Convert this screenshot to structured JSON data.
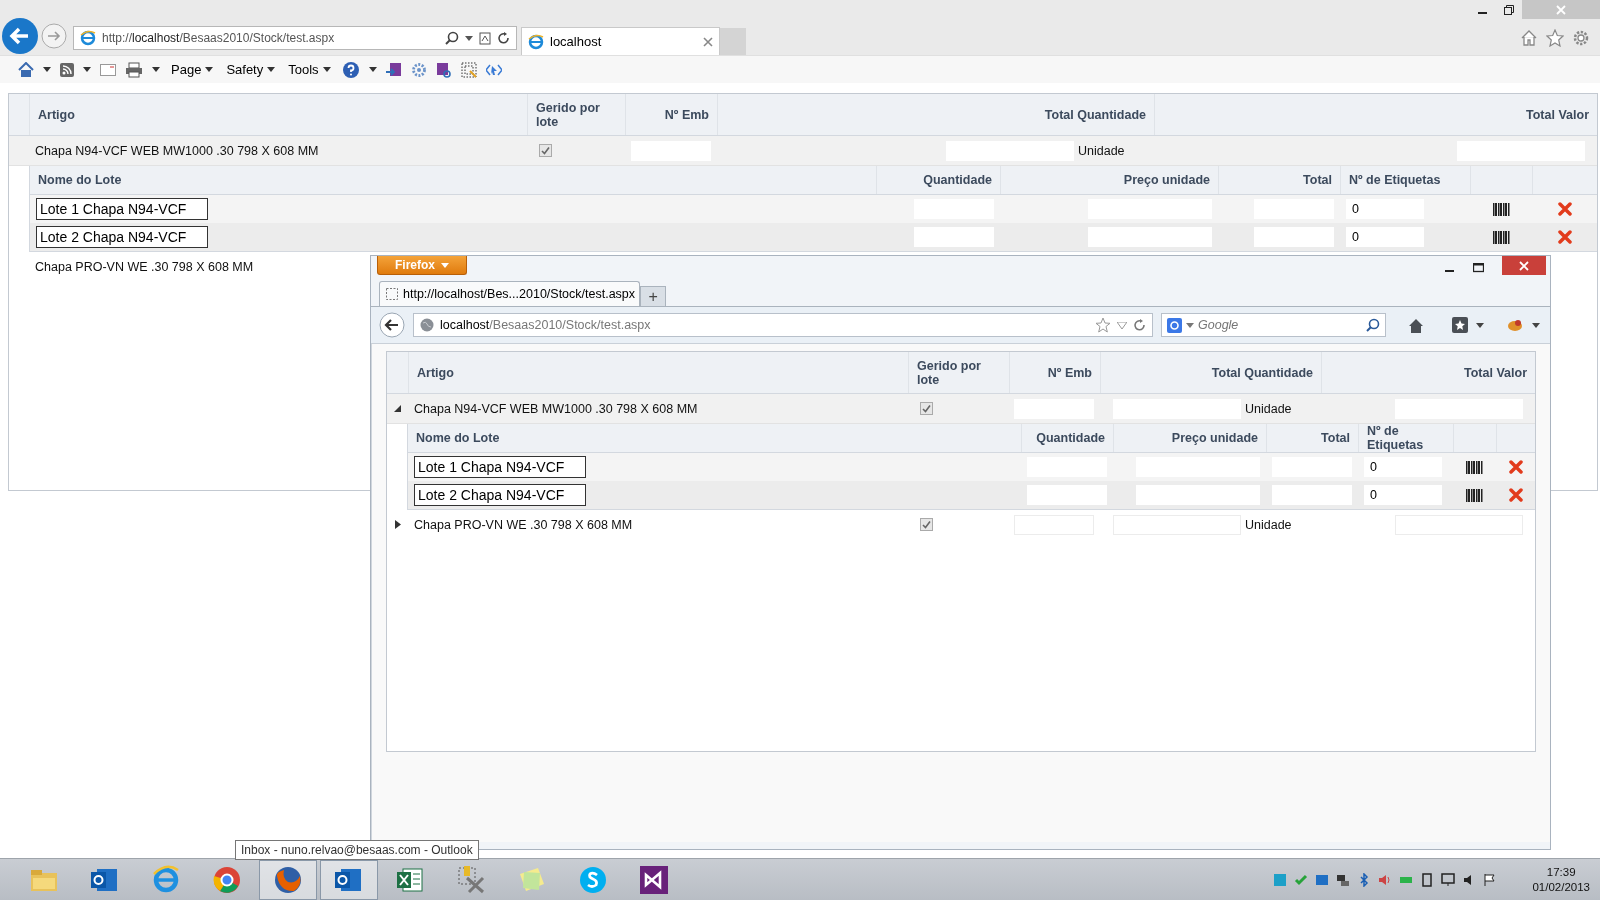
{
  "ie": {
    "address": "http://**localhost**/Besaas2010/Stock/test.aspx",
    "tab": "localhost",
    "commands": [
      "Page",
      "Safety",
      "Tools"
    ],
    "grid": {
      "columns": [
        "Artigo",
        "Gerido por lote",
        "Nº Emb",
        "Total Quantidade",
        "Total Valor"
      ],
      "rows": [
        {
          "name": "Chapa N94-VCF WEB MW1000 .30 798 X 608 MM",
          "managed": true,
          "unit": "Unidade",
          "lots": {
            "columns": [
              "Nome do Lote",
              "Quantidade",
              "Preço unidade",
              "Total",
              "Nº de Etiquetas"
            ],
            "rows": [
              {
                "name": "Lote 1 Chapa N94-VCF",
                "labels": "0"
              },
              {
                "name": "Lote 2 Chapa N94-VCF",
                "labels": "0"
              }
            ]
          }
        },
        {
          "name": "Chapa PRO-VN WE .30 798 X 608 MM"
        }
      ]
    }
  },
  "firefox": {
    "menu_button": "Firefox",
    "tab": "http://localhost/Bes...2010/Stock/test.aspx",
    "new_tab": "+",
    "address_host": "localhost",
    "address_path": "/Besaas2010/Stock/test.aspx",
    "search_placeholder": "Google",
    "grid": {
      "columns": [
        "Artigo",
        "Gerido por lote",
        "Nº Emb",
        "Total Quantidade",
        "Total Valor"
      ],
      "rows": [
        {
          "name": "Chapa N94-VCF WEB MW1000 .30 798 X 608 MM",
          "expanded": true,
          "managed": true,
          "unit": "Unidade",
          "lots": {
            "columns": [
              "Nome do Lote",
              "Quantidade",
              "Preço unidade",
              "Total",
              "Nº de Etiquetas"
            ],
            "rows": [
              {
                "name": "Lote 1 Chapa N94-VCF",
                "labels": "0"
              },
              {
                "name": "Lote 2 Chapa N94-VCF",
                "labels": "0"
              }
            ]
          }
        },
        {
          "name": "Chapa PRO-VN WE .30 798 X 608 MM",
          "expanded": false,
          "managed": true,
          "unit": "Unidade"
        }
      ]
    }
  },
  "tooltip": "Inbox - nuno.relvao@besaas.com - Outlook",
  "taskbar": {
    "apps": [
      {
        "kind": "folder",
        "selected": false
      },
      {
        "kind": "outlook",
        "selected": false
      },
      {
        "kind": "ie",
        "selected": false
      },
      {
        "kind": "chrome",
        "selected": false
      },
      {
        "kind": "firefox",
        "selected": true
      },
      {
        "kind": "outlook",
        "selected": true
      },
      {
        "kind": "excel",
        "selected": false
      },
      {
        "kind": "tools",
        "selected": false
      },
      {
        "kind": "notes",
        "selected": false
      },
      {
        "kind": "skype",
        "selected": false
      },
      {
        "kind": "studio",
        "selected": false
      }
    ],
    "time": "17:39",
    "date": "01/02/2013"
  }
}
